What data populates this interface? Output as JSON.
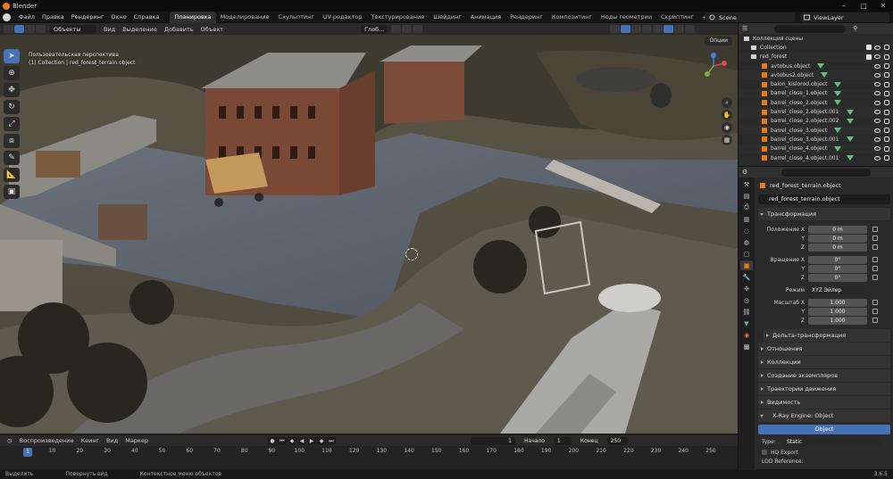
{
  "window": {
    "title": "Blender"
  },
  "menu": [
    "Файл",
    "Правка",
    "Рендеринг",
    "Окно",
    "Справка"
  ],
  "workspaces": [
    "Планировка",
    "Моделирование",
    "Скульптинг",
    "UV-редактор",
    "Текстурирование",
    "Шейдинг",
    "Анимация",
    "Рендеринг",
    "Композитинг",
    "Ноды геометрии",
    "Скриптинг"
  ],
  "scene_selector": "Scene",
  "view_layer": "ViewLayer",
  "viewport_header": {
    "mode": "Объекты",
    "menus": [
      "Вид",
      "Выделение",
      "Добавить",
      "Объект"
    ],
    "transform_orientation": "Глоб...",
    "options": "Опции"
  },
  "viewport": {
    "perspective_label": "Пользовательская перспектива",
    "collection_label": "(1) Collection | red_forest_terrain.object"
  },
  "outliner": {
    "root": "Коллекция сцены",
    "items": [
      {
        "name": "Collection",
        "type": "collection"
      },
      {
        "name": "red_forest",
        "type": "collection"
      },
      {
        "name": "avtobus.object",
        "type": "object"
      },
      {
        "name": "avtobus2.object",
        "type": "object"
      },
      {
        "name": "balon_kislorod.object",
        "type": "object"
      },
      {
        "name": "barrel_close_1.object",
        "type": "object"
      },
      {
        "name": "barrel_close_2.object",
        "type": "object"
      },
      {
        "name": "barrel_close_2.object.001",
        "type": "object"
      },
      {
        "name": "barrel_close_2.object.002",
        "type": "object"
      },
      {
        "name": "barrel_close_3.object",
        "type": "object"
      },
      {
        "name": "barrel_close_3.object.001",
        "type": "object"
      },
      {
        "name": "barrel_close_4.object",
        "type": "object"
      },
      {
        "name": "barrel_close_4.object.001",
        "type": "object"
      }
    ]
  },
  "properties": {
    "object_name": "red_forest_terrain.object",
    "name_field": "red_forest_terrain.object",
    "transform_section": "Трансформация",
    "location_label": "Положение X",
    "rotation_label": "Вращение X",
    "scale_label": "Масштаб X",
    "axis_y": "Y",
    "axis_z": "Z",
    "location": [
      "0 m",
      "0 m",
      "0 m"
    ],
    "rotation": [
      "0°",
      "0°",
      "0°"
    ],
    "rotation_mode_label": "Режим",
    "rotation_mode": "XYZ Эйлер",
    "scale": [
      "1.000",
      "1.000",
      "1.000"
    ],
    "delta_transform": "Дельта-трансформация",
    "sections": [
      "Отношения",
      "Коллекции",
      "Создание экземпляров",
      "Траектории движения",
      "Видимость"
    ],
    "xray_section": "X-Ray Engine: Object",
    "object_button": "Object",
    "type_label": "Type:",
    "type_value": "Static",
    "hq_export": "HQ Export",
    "lod_reference": "LOD Reference:"
  },
  "timeline": {
    "menus": [
      "Воспроизведение",
      "Кеинг",
      "Вид",
      "Маркер"
    ],
    "current_frame": "1",
    "start_label": "Начало",
    "start": "1",
    "end_label": "Конец",
    "end": "250",
    "ticks": [
      "1",
      "10",
      "20",
      "30",
      "40",
      "50",
      "60",
      "70",
      "80",
      "90",
      "100",
      "110",
      "120",
      "130",
      "140",
      "150",
      "160",
      "170",
      "180",
      "190",
      "200",
      "210",
      "220",
      "230",
      "240",
      "250"
    ]
  },
  "statusbar": {
    "select": "Выделить",
    "rotate": "Повернуть вид",
    "context": "Контекстное меню объектов",
    "version": "3.6.5"
  },
  "colors": {
    "accent": "#4772b3",
    "object_orange": "#e87d0d",
    "mesh_green": "#5ec27e"
  }
}
